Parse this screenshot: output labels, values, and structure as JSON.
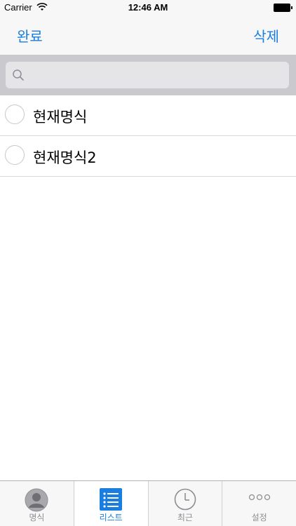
{
  "status_bar": {
    "carrier": "Carrier",
    "time": "12:46 AM"
  },
  "nav": {
    "done_label": "완료",
    "delete_label": "삭제"
  },
  "search": {
    "value": "",
    "placeholder": ""
  },
  "list": {
    "items": [
      {
        "label": "현재명식"
      },
      {
        "label": "현재명식2"
      }
    ]
  },
  "tabs": [
    {
      "label": "명식",
      "icon": "person-icon",
      "active": false
    },
    {
      "label": "리스트",
      "icon": "list-icon",
      "active": true
    },
    {
      "label": "최근",
      "icon": "clock-icon",
      "active": false
    },
    {
      "label": "설정",
      "icon": "more-icon",
      "active": false
    }
  ],
  "colors": {
    "accent": "#1a7de0",
    "inactive": "#8e8e93"
  }
}
